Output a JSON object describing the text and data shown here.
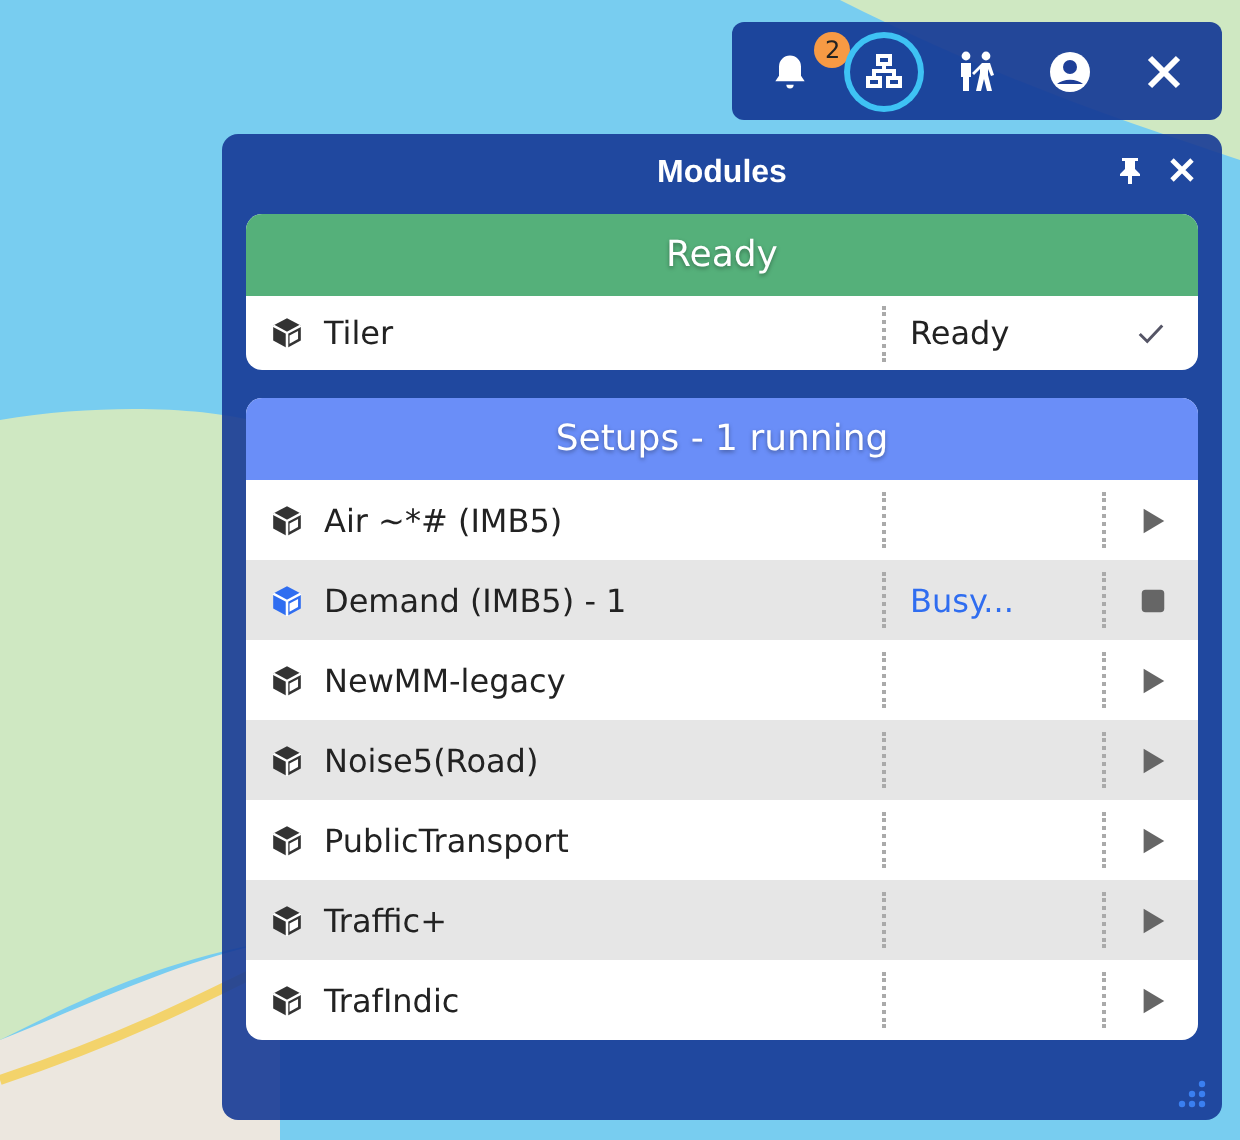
{
  "toolbar": {
    "notifications": {
      "count": "2"
    },
    "items": [
      {
        "kind": "network",
        "selected": true
      },
      {
        "kind": "people",
        "selected": false
      },
      {
        "kind": "account",
        "selected": false
      },
      {
        "kind": "close",
        "selected": false
      }
    ]
  },
  "panel": {
    "title": "Modules",
    "groups": [
      {
        "title": "Ready",
        "color": "#55b07a",
        "modules": [
          {
            "name": "Tiler",
            "status": "Ready",
            "running": false,
            "kind": "done"
          }
        ]
      },
      {
        "title": "Setups - 1 running",
        "color": "#6a8ef8",
        "modules": [
          {
            "name": "Air ~*# (IMB5)",
            "running": false,
            "kind": "play"
          },
          {
            "name": "Demand (IMB5) - 1",
            "status": "Busy...",
            "running": true,
            "kind": "stop"
          },
          {
            "name": "NewMM-legacy",
            "running": false,
            "kind": "play"
          },
          {
            "name": "Noise5(Road)",
            "running": false,
            "kind": "play"
          },
          {
            "name": "PublicTransport",
            "running": false,
            "kind": "play"
          },
          {
            "name": "Traffic+",
            "running": false,
            "kind": "play"
          },
          {
            "name": "TrafIndic",
            "running": false,
            "kind": "play"
          }
        ]
      }
    ]
  }
}
